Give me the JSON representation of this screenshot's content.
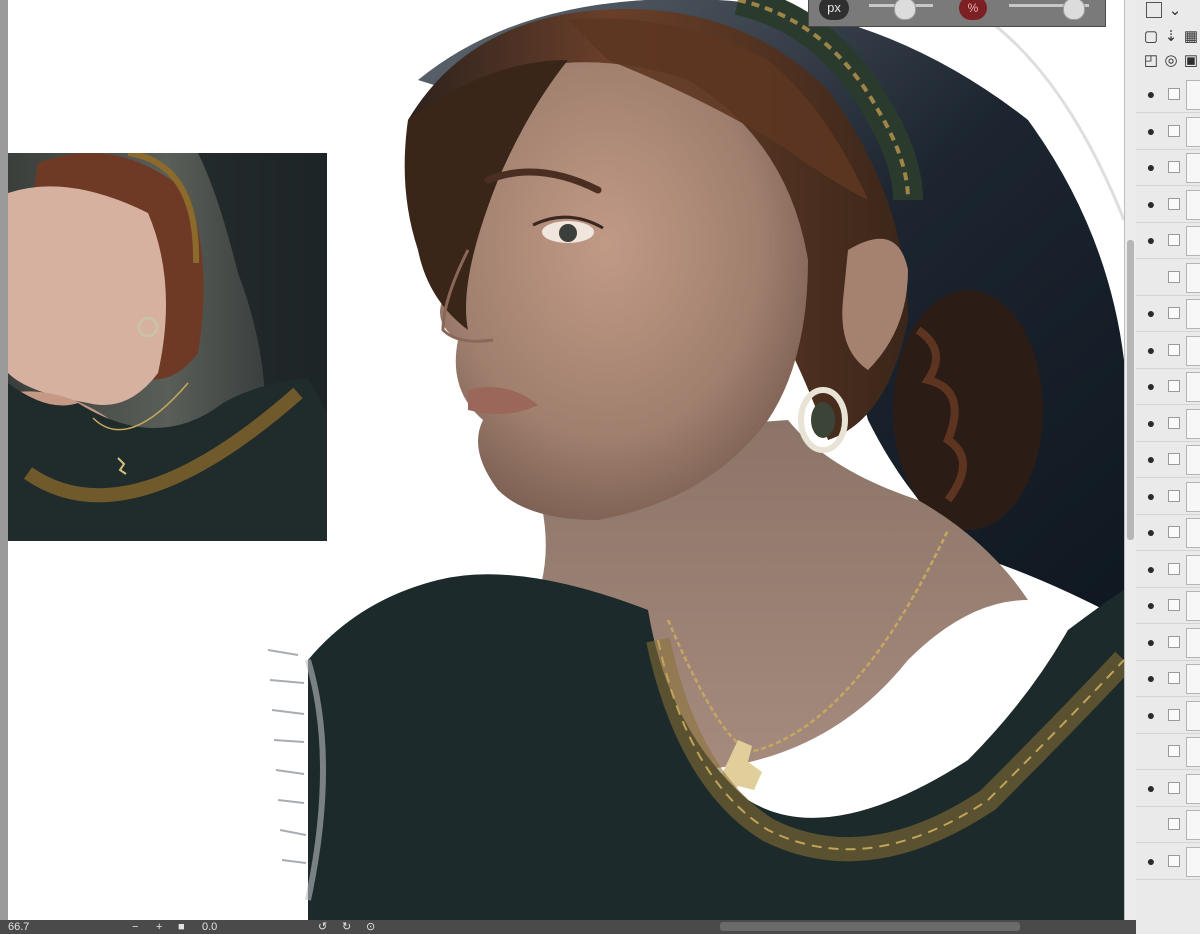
{
  "toolbar": {
    "unit_label": "px",
    "opacity_unit_label": "%",
    "brush_size_fraction": 0.55,
    "opacity_fraction": 0.8
  },
  "status": {
    "zoom": "66.7",
    "zoom_out": "−",
    "zoom_in": "+",
    "fit": "■",
    "rotation": "0.0"
  },
  "layers_panel": {
    "visible_flags": [
      true,
      true,
      true,
      true,
      true,
      false,
      true,
      true,
      true,
      true,
      true,
      true,
      true,
      true,
      true,
      true,
      true,
      true,
      false,
      true,
      false,
      true
    ]
  }
}
